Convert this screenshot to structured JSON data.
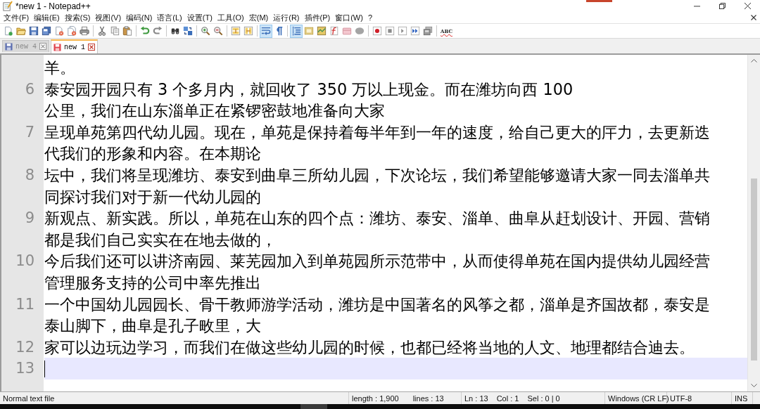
{
  "window": {
    "title": "*new 1 - Notepad++"
  },
  "menu": {
    "items": [
      "文件(F)",
      "编辑(E)",
      "搜索(S)",
      "视图(V)",
      "编码(N)",
      "语言(L)",
      "设置(T)",
      "工具(O)",
      "宏(M)",
      "运行(R)",
      "插件(P)",
      "窗口(W)",
      "?"
    ]
  },
  "toolbar": {
    "groups": [
      [
        {
          "pressed": false
        },
        {
          "pressed": false
        },
        {
          "pressed": false
        },
        {
          "pressed": false
        },
        {
          "pressed": false
        },
        {
          "pressed": false
        },
        {
          "pressed": false
        }
      ],
      [
        {
          "pressed": false
        },
        {
          "pressed": false
        },
        {
          "pressed": false
        }
      ],
      [
        {
          "pressed": false
        },
        {
          "pressed": false
        }
      ],
      [
        {
          "pressed": false
        },
        {
          "pressed": false
        }
      ],
      [
        {
          "pressed": false
        },
        {
          "pressed": false
        }
      ],
      [
        {
          "pressed": false
        },
        {
          "pressed": false
        }
      ],
      [
        {
          "pressed": true
        },
        {
          "pressed": false
        }
      ],
      [
        {
          "pressed": true
        },
        {
          "pressed": false
        },
        {
          "pressed": false
        },
        {
          "pressed": false
        },
        {
          "pressed": false
        },
        {
          "pressed": false
        }
      ],
      [
        {
          "pressed": false
        },
        {
          "pressed": false
        },
        {
          "pressed": false
        },
        {
          "pressed": false
        },
        {
          "pressed": false
        }
      ]
    ],
    "spellcheck": "ABC"
  },
  "tabs": [
    {
      "label": "new 4",
      "selected": false,
      "modified": false
    },
    {
      "label": "new 1",
      "selected": true,
      "modified": true
    }
  ],
  "editor": {
    "lines": [
      {
        "rows": [
          "羊。"
        ],
        "current": false
      },
      {
        "number": "6",
        "rows": [
          "泰安园开园只有 3 个多月内，就回收了 350 万以上现金。而在潍坊向西 100",
          "公里，我们在山东淄单正在紧锣密鼓地准备向大家"
        ],
        "current": false
      },
      {
        "number": "7",
        "rows": [
          "呈现单苑第四代幼儿园。现在，单苑是保持着每半年到一年的速度，给自己更大的厈力，去更新迭",
          "代我们的形象和内容。在本期论"
        ],
        "current": false
      },
      {
        "number": "8",
        "rows": [
          "坛中，我们将呈现潍坊、泰安到曲阜三所幼儿园，下次论坛，我们希望能够邀请大家一同去淄单共",
          "同探讨我们对于新一代幼儿园的"
        ],
        "current": false
      },
      {
        "number": "9",
        "rows": [
          "新观点、新实践。所以，单苑在山东的四个点：潍坊、泰安、淄单、曲阜从赶划设计、开园、营销",
          "都是我们自己实实在在地去做的，"
        ],
        "current": false
      },
      {
        "number": "10",
        "rows": [
          "今后我们还可以讲济南园、莱芜园加入到单苑园所示范带中，从而使得单苑在国内提供幼儿园经营",
          "管理服务支持的公司中率先推出"
        ],
        "current": false
      },
      {
        "number": "11",
        "rows": [
          "一个中国幼儿园园长、骨干教师游学活动，潍坊是中国著名的风筝之都，淄单是齐国故都，泰安是",
          "泰山脚下，曲阜是孔子畋里，大"
        ],
        "current": false
      },
      {
        "number": "12",
        "rows": [
          "家可以边玩边学习，而我们在做这些幼儿园的时候，也都已经将当地的人文、地理都结合迪去。"
        ],
        "current": false
      },
      {
        "number": "13",
        "current": true
      }
    ]
  },
  "status_bar": {
    "file_type": "Normal text file",
    "length": "length : 1,900",
    "lines": "lines : 13",
    "ln": "Ln : 13",
    "col": "Col : 1",
    "sel": "Sel : 0 | 0",
    "eol": "Windows (CR LF)",
    "encoding": "UTF-8",
    "mode": "INS"
  }
}
